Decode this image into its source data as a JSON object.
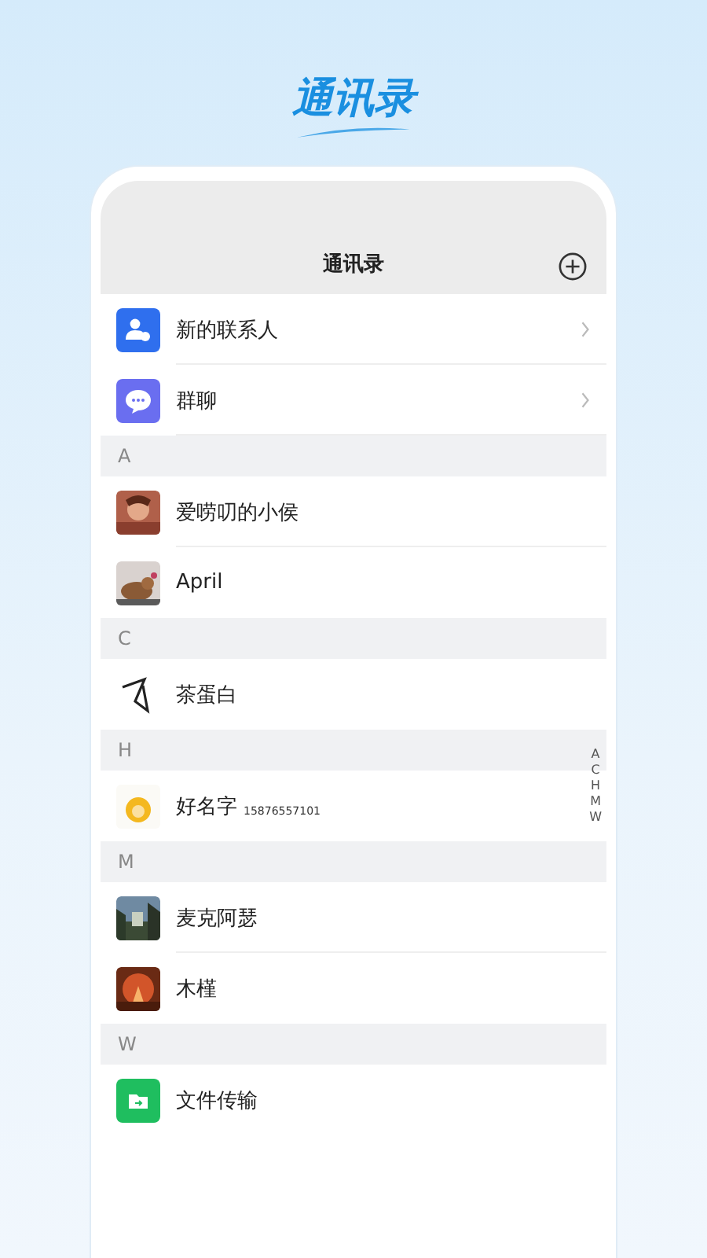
{
  "banner_title": "通讯录",
  "header": {
    "title": "通讯录"
  },
  "entries": [
    {
      "label": "新的联系人",
      "kind": "new-contact"
    },
    {
      "label": "群聊",
      "kind": "group-chat"
    }
  ],
  "sections": [
    {
      "letter": "A",
      "contacts": [
        {
          "name": "爱唠叨的小侯",
          "kind": "picture"
        },
        {
          "name": "April",
          "kind": "picture"
        }
      ]
    },
    {
      "letter": "C",
      "contacts": [
        {
          "name": "茶蛋白",
          "kind": "picture"
        }
      ]
    },
    {
      "letter": "H",
      "contacts": [
        {
          "name": "好名字",
          "phone": "15876557101",
          "kind": "picture"
        }
      ]
    },
    {
      "letter": "M",
      "contacts": [
        {
          "name": "麦克阿瑟",
          "kind": "picture"
        },
        {
          "name": "木槿",
          "kind": "picture"
        }
      ]
    },
    {
      "letter": "W",
      "contacts": [
        {
          "name": "文件传输",
          "kind": "file-transfer"
        }
      ]
    }
  ],
  "index": [
    "A",
    "C",
    "H",
    "M",
    "W"
  ]
}
